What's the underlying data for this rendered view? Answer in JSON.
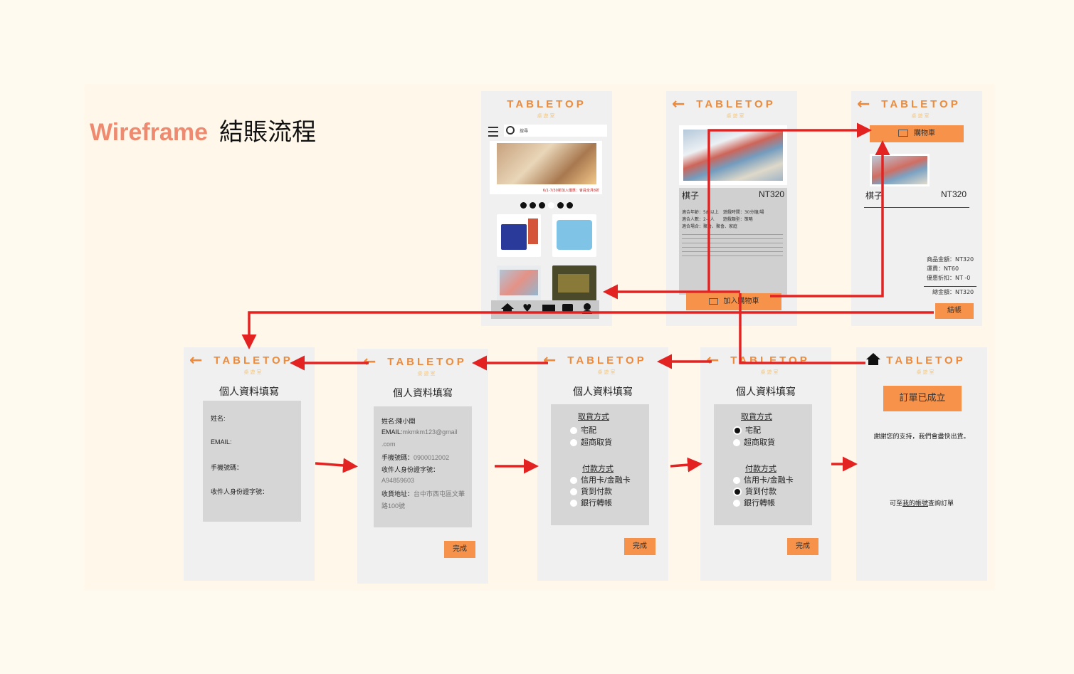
{
  "title": {
    "part1": "Wireframe",
    "part2": "結賬流程"
  },
  "brand": "TABLETOP",
  "subbrand": "桌遊室",
  "back_arrow": "←",
  "home_screen": {
    "search_placeholder": "搜尋",
    "banner_caption": "6/1-7/30新加入優惠：會員全月8折",
    "carousel_dots": 6,
    "nav_items": [
      "home-icon",
      "heart-icon",
      "cart-icon",
      "chat-icon",
      "user-icon"
    ]
  },
  "product_screen": {
    "name": "棋子",
    "price": "NT320",
    "spec_lines": [
      "適合年齡：5歲以上　遊戲時間：30分鐘/場",
      "適合人數：2-4人　　遊戲類型：策略",
      "適合場合：聚會、聚會、家庭"
    ],
    "add_to_cart": "加入購物車"
  },
  "cart_screen": {
    "cart_label": "購物車",
    "item_name": "棋子",
    "item_price": "NT320",
    "subtotal": "商品金額：NT320",
    "shipping": "運費：NT60",
    "discount": "優惠折扣：NT -0",
    "total": "總金額：NT320",
    "checkout": "結帳"
  },
  "form_empty": {
    "heading": "個人資料填寫",
    "fields": [
      "姓名:",
      "EMAIL:",
      "手機號碼：",
      "收件人身份證字號："
    ]
  },
  "form_filled": {
    "heading": "個人資料填寫",
    "name_label": "姓名:",
    "name_value": "陳小開",
    "email_label": "EMAIL:",
    "email_value": "mkmkm123@gmail",
    "email_value2": ".com",
    "phone_label": "手機號碼：",
    "phone_value": "0900012002",
    "id_label": "收件人身份證字號：",
    "id_value": "A94859603",
    "addr_label": "收貨地址：",
    "addr_value": "台中市西屯區文華",
    "addr_value2": "路100號",
    "done": "完成"
  },
  "shipping_empty": {
    "heading": "個人資料填寫",
    "pickup_title": "取貨方式",
    "pickup_options": [
      "宅配",
      "超商取貨"
    ],
    "payment_title": "付款方式",
    "payment_options": [
      "信用卡/金融卡",
      "貨到付款",
      "銀行轉帳"
    ],
    "done": "完成"
  },
  "shipping_selected": {
    "heading": "個人資料填寫",
    "pickup_title": "取貨方式",
    "pickup_options": [
      "宅配",
      "超商取貨"
    ],
    "payment_title": "付款方式",
    "payment_options": [
      "信用卡/金融卡",
      "貨到付款",
      "銀行轉帳"
    ],
    "pickup_selected": 0,
    "payment_selected": 1,
    "done": "完成"
  },
  "success_screen": {
    "order_done": "訂單已成立",
    "thanks": "謝謝您的支持，我們會盡快出貨。",
    "lookup_prefix": "可至",
    "lookup_link": "我的帳號",
    "lookup_suffix": "查詢訂單"
  },
  "colors": {
    "accent": "#ee8a3a",
    "button": "#f7924a",
    "arrow": "#e32222",
    "title": "#ee8a70"
  }
}
